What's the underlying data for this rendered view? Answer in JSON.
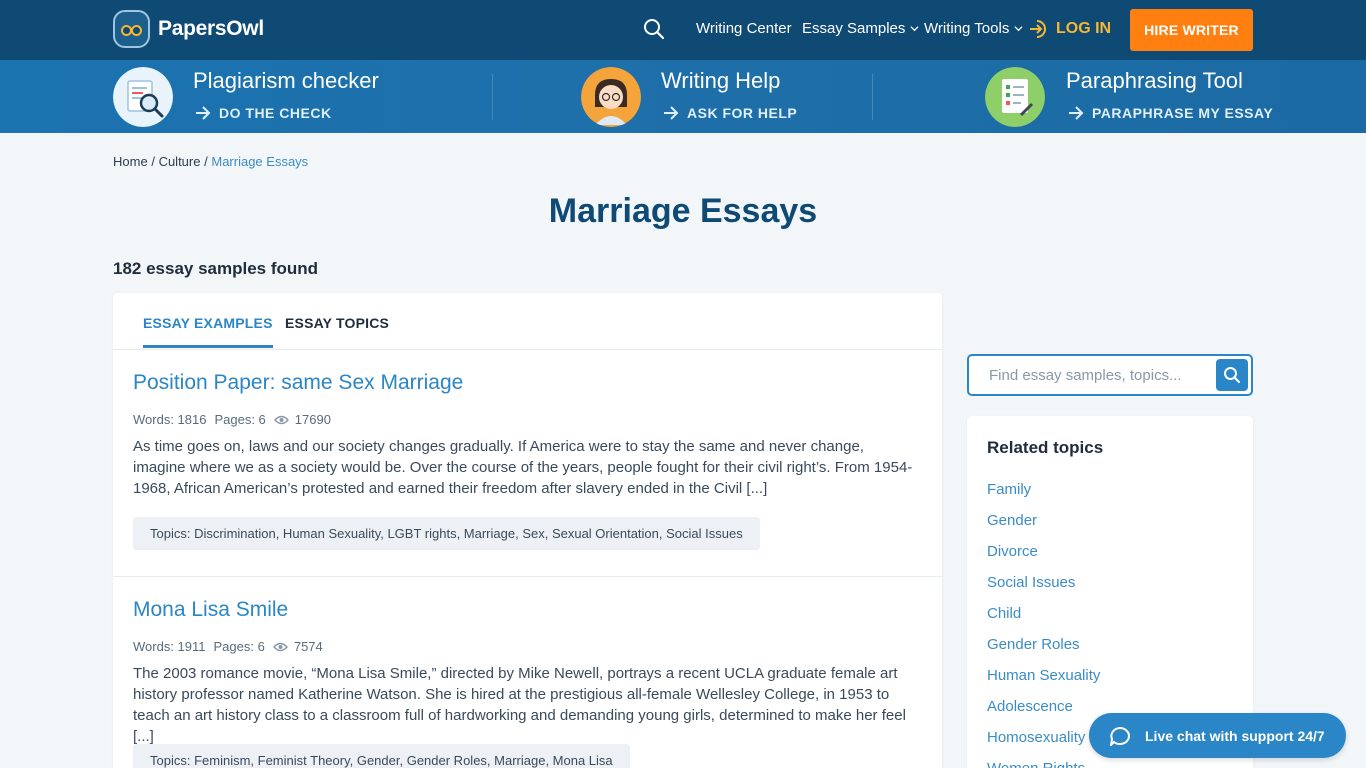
{
  "brand": {
    "name": "PapersOwl"
  },
  "nav": {
    "links": [
      {
        "label": "Writing Center"
      },
      {
        "label": "Essay Samples"
      },
      {
        "label": "Writing Tools"
      }
    ],
    "login_label": "LOG IN",
    "hire_label": "HIRE WRITER"
  },
  "services": [
    {
      "title": "Plagiarism checker",
      "cta": "DO THE CHECK"
    },
    {
      "title": "Writing Help",
      "cta": "ASK FOR HELP"
    },
    {
      "title": "Paraphrasing Tool",
      "cta": "PARAPHRASE MY ESSAY"
    }
  ],
  "breadcrumb": {
    "items": [
      "Home",
      "Culture"
    ],
    "separator": "/",
    "current": "Marriage Essays"
  },
  "page": {
    "title": "Marriage Essays",
    "count_text": "182 essay samples found"
  },
  "tabs": [
    {
      "label": "ESSAY EXAMPLES",
      "active": true
    },
    {
      "label": "ESSAY TOPICS",
      "active": false
    }
  ],
  "essays": [
    {
      "title": "Position Paper: same Sex Marriage",
      "words": "Words: 1816",
      "pages": "Pages: 6",
      "views": "17690",
      "excerpt": "As time goes on, laws and our society changes gradually. If America were to stay the same and never change, imagine where we as a society would be. Over the course of the years, people fought for their civil right’s. From 1954-1968, African American’s protested and earned their freedom after slavery ended in the Civil [...]",
      "topics": "Topics: Discrimination, Human Sexuality, LGBT rights, Marriage, Sex, Sexual Orientation, Social Issues"
    },
    {
      "title": "Mona Lisa Smile",
      "words": "Words: 1911",
      "pages": "Pages: 6",
      "views": "7574",
      "excerpt": "The 2003 romance movie, “Mona Lisa Smile,” directed by Mike Newell, portrays a recent UCLA graduate female art history professor named Katherine Watson. She is hired at the prestigious all-female Wellesley College, in 1953 to teach an art history class to a classroom full of hardworking and demanding young girls, determined to make her feel [...]",
      "topics": "Topics: Feminism, Feminist Theory, Gender, Gender Roles, Marriage, Mona Lisa"
    }
  ],
  "sidebar": {
    "search_placeholder": "Find essay samples, topics...",
    "related_title": "Related topics",
    "related": [
      "Family",
      "Gender",
      "Divorce",
      "Social Issues",
      "Child",
      "Gender Roles",
      "Human Sexuality",
      "Adolescence",
      "Homosexuality",
      "Women Rights"
    ]
  },
  "chat": {
    "label": "Live chat with support 24/7"
  },
  "colors": {
    "nav_bg": "#0f4a75",
    "band_bg": "#1b73b0",
    "accent": "#2a86c6",
    "cta_orange": "#ff7f11",
    "login_yellow": "#f7b733"
  }
}
